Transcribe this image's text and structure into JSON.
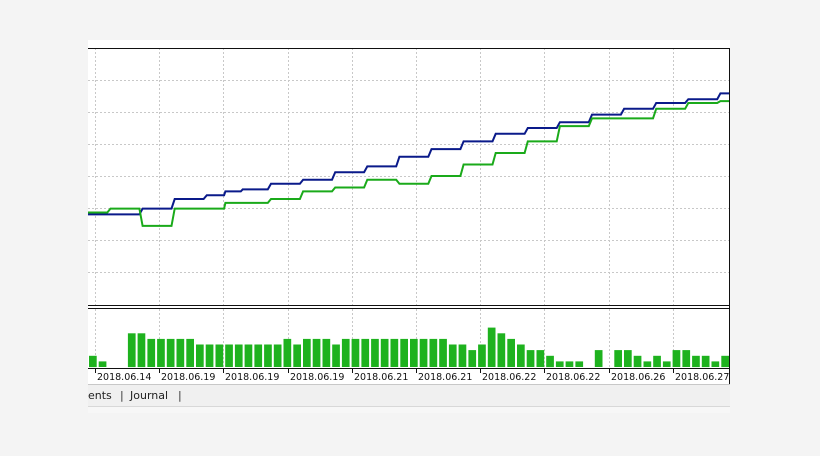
{
  "tabs": [
    {
      "label": "ents"
    },
    {
      "label": "Journal"
    }
  ],
  "colors": {
    "balance_line": "#0a1a8a",
    "equity_line": "#1aaa1a",
    "deposit_bars": "#1eb21e",
    "grid": "#c8c8c8"
  },
  "chart_data": [
    {
      "type": "line",
      "title": "",
      "xlabel": "",
      "ylabel": "",
      "grid": true,
      "x": [
        0,
        5,
        10,
        15,
        20,
        22,
        25,
        30,
        35,
        40,
        45,
        50,
        55,
        60,
        65,
        70,
        75,
        80,
        85,
        90,
        95,
        100
      ],
      "ylim": [
        0,
        100
      ],
      "series": [
        {
          "values": [
            30,
            30,
            33,
            38,
            40,
            42,
            43,
            46,
            48,
            52,
            55,
            60,
            64,
            68,
            72,
            75,
            78,
            82,
            85,
            88,
            90,
            93
          ]
        },
        {
          "values": [
            31,
            33,
            24,
            33,
            33,
            36,
            36,
            38,
            42,
            44,
            48,
            46,
            50,
            56,
            62,
            68,
            76,
            80,
            80,
            85,
            88,
            89
          ]
        }
      ]
    },
    {
      "type": "bar",
      "categories": [
        "2018.06.14",
        "2018.06.19",
        "2018.06.19",
        "2018.06.19",
        "2018.06.21",
        "2018.06.21",
        "2018.06.22",
        "2018.06.22",
        "2018.06.26",
        "2018.06.27"
      ],
      "values": [
        2,
        1,
        0,
        0,
        6,
        6,
        5,
        5,
        5,
        5,
        5,
        4,
        4,
        4,
        4,
        4,
        4,
        4,
        4,
        4,
        5,
        4,
        5,
        5,
        5,
        4,
        5,
        5,
        5,
        5,
        5,
        5,
        5,
        5,
        5,
        5,
        5,
        4,
        4,
        3,
        4,
        7,
        6,
        5,
        4,
        3,
        3,
        2,
        1,
        1,
        1,
        0,
        3,
        0,
        3,
        3,
        2,
        1,
        2,
        1,
        3,
        3,
        2,
        2,
        1,
        2
      ],
      "ylim": [
        0,
        8
      ],
      "grid": false
    }
  ]
}
